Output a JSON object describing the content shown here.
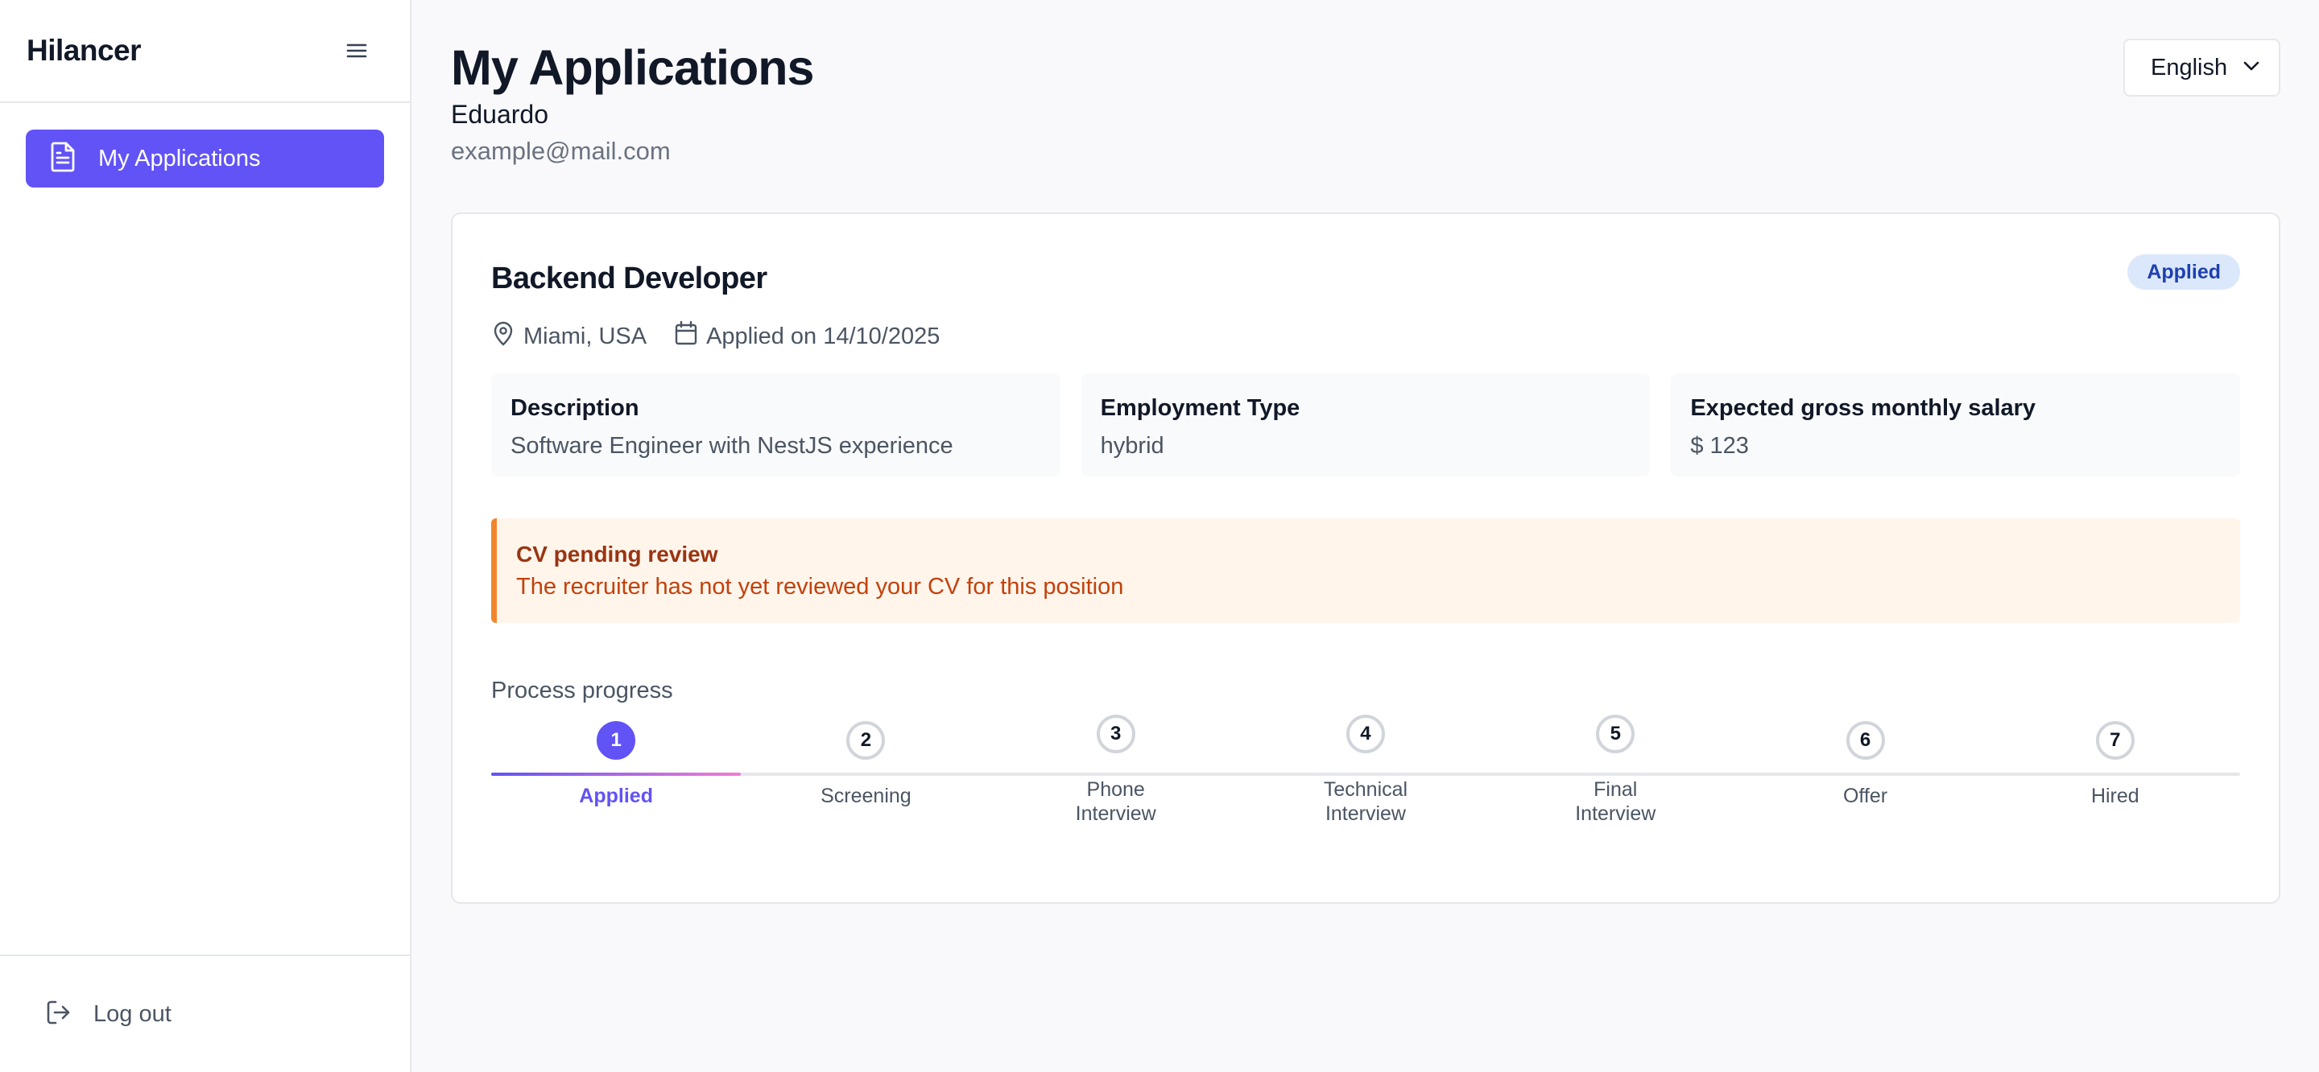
{
  "sidebar": {
    "brand": "Hilancer",
    "menu_icon": "hamburger-icon",
    "items": [
      {
        "label": "My Applications",
        "icon": "document-icon",
        "active": true
      }
    ],
    "logout": {
      "label": "Log out",
      "icon": "logout-icon"
    }
  },
  "header": {
    "title": "My Applications",
    "user_name": "Eduardo",
    "user_email": "example@mail.com",
    "language": "English"
  },
  "application": {
    "job_title": "Backend Developer",
    "status": "Applied",
    "location": "Miami, USA",
    "applied_on": "Applied on 14/10/2025",
    "details": [
      {
        "label": "Description",
        "value": "Software Engineer with NestJS experience"
      },
      {
        "label": "Employment Type",
        "value": "hybrid"
      },
      {
        "label": "Expected gross monthly salary",
        "value": "$ 123"
      }
    ],
    "alert": {
      "title": "CV pending review",
      "text": "The recruiter has not yet reviewed your CV for this position"
    },
    "progress": {
      "label": "Process progress",
      "current_step": 1,
      "steps": [
        {
          "number": "1",
          "line1": "Applied",
          "line2": ""
        },
        {
          "number": "2",
          "line1": "Screening",
          "line2": ""
        },
        {
          "number": "3",
          "line1": "Phone",
          "line2": "Interview"
        },
        {
          "number": "4",
          "line1": "Technical",
          "line2": "Interview"
        },
        {
          "number": "5",
          "line1": "Final",
          "line2": "Interview"
        },
        {
          "number": "6",
          "line1": "Offer",
          "line2": ""
        },
        {
          "number": "7",
          "line1": "Hired",
          "line2": ""
        }
      ]
    }
  },
  "colors": {
    "accent": "#6153f5",
    "badge_bg": "#dbe8fb",
    "alert_border": "#f0852d"
  }
}
